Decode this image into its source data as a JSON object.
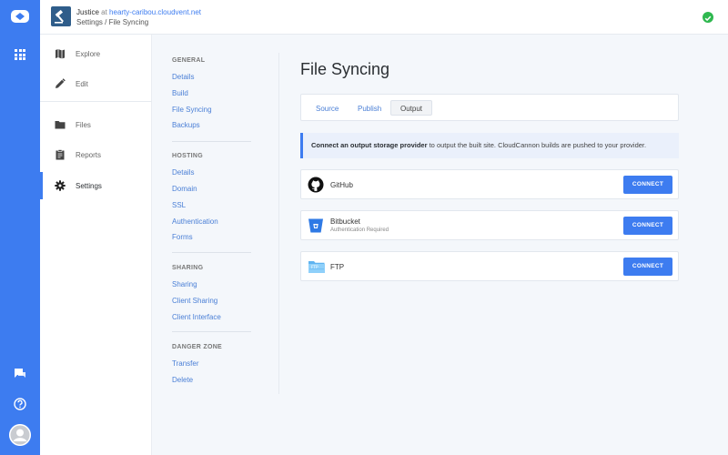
{
  "topbar": {
    "site_name": "Justice",
    "at": "at",
    "domain": "hearty-caribou.cloudvent.net",
    "breadcrumb": "Settings / File Syncing"
  },
  "nav": {
    "items": [
      {
        "label": "Explore",
        "icon": "map-icon"
      },
      {
        "label": "Edit",
        "icon": "pencil-icon"
      },
      {
        "label": "Files",
        "icon": "folder-icon"
      },
      {
        "label": "Reports",
        "icon": "clipboard-icon"
      },
      {
        "label": "Settings",
        "icon": "gear-icon",
        "active": true
      }
    ]
  },
  "subnav": {
    "general": {
      "title": "GENERAL",
      "links": [
        "Details",
        "Build",
        "File Syncing",
        "Backups"
      ]
    },
    "hosting": {
      "title": "HOSTING",
      "links": [
        "Details",
        "Domain",
        "SSL",
        "Authentication",
        "Forms"
      ]
    },
    "sharing": {
      "title": "SHARING",
      "links": [
        "Sharing",
        "Client Sharing",
        "Client Interface"
      ]
    },
    "danger": {
      "title": "DANGER ZONE",
      "links": [
        "Transfer",
        "Delete"
      ]
    }
  },
  "main": {
    "title": "File Syncing",
    "tabs": [
      "Source",
      "Publish",
      "Output"
    ],
    "active_tab": "Output",
    "notice_bold": "Connect an output storage provider",
    "notice_rest": " to output the built site. CloudCannon builds are pushed to your provider.",
    "providers": [
      {
        "name": "GitHub",
        "sub": "",
        "button": "CONNECT",
        "icon": "github-icon"
      },
      {
        "name": "Bitbucket",
        "sub": "Authentication Required",
        "button": "CONNECT",
        "icon": "bitbucket-icon"
      },
      {
        "name": "FTP",
        "sub": "",
        "button": "CONNECT",
        "icon": "ftp-folder-icon"
      }
    ]
  },
  "colors": {
    "accent": "#3d7cf0",
    "success": "#2fb84f"
  }
}
